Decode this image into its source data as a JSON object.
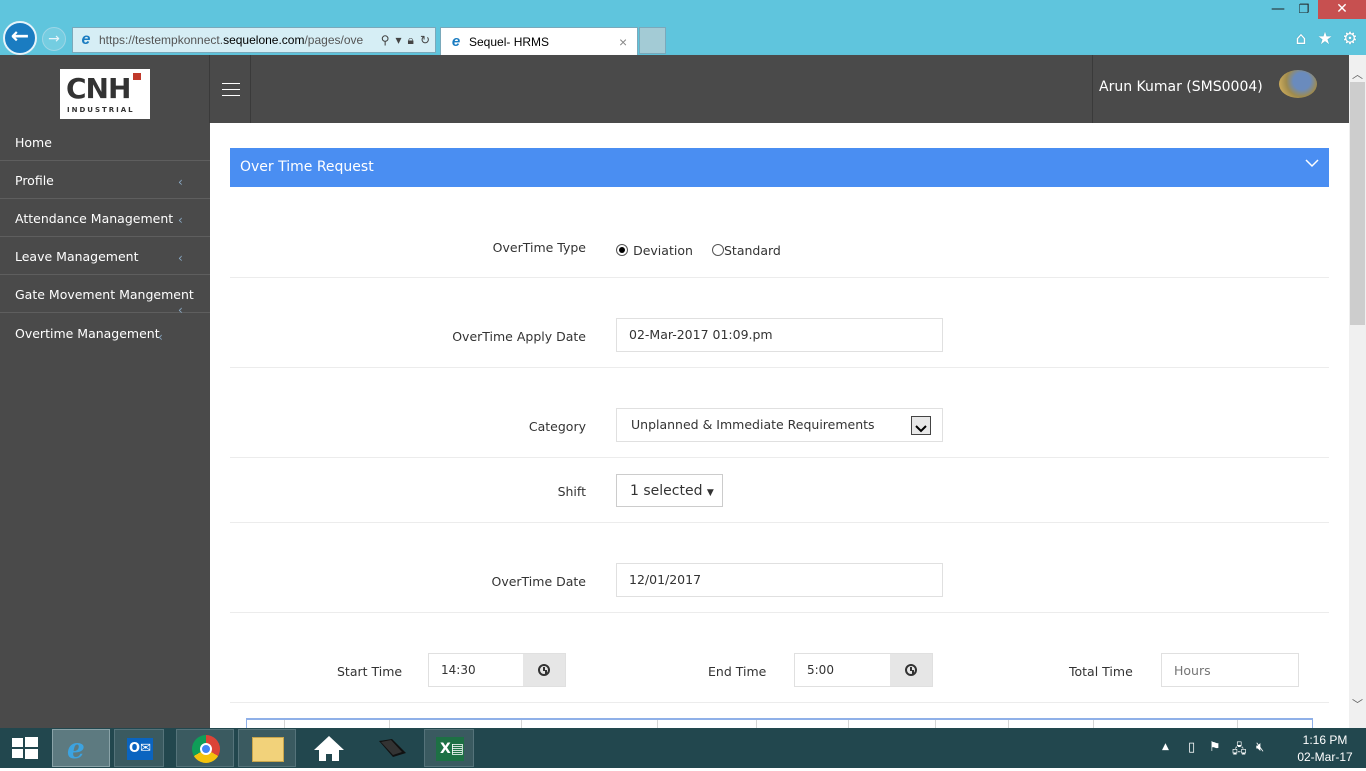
{
  "browser": {
    "url_prefix": "https://testempkonnect.",
    "url_domain": "sequelone.com",
    "url_suffix": "/pages/ove",
    "tab_title": "Sequel- HRMS",
    "tab_close": "×",
    "window_min": "—",
    "window_max": "❐",
    "window_close": "✕",
    "icons": {
      "home": "⌂",
      "favorites": "★",
      "settings": "⚙"
    }
  },
  "header": {
    "logo_main": "CNH",
    "logo_sub": "INDUSTRIAL",
    "user_name": "Arun Kumar (SMS0004)"
  },
  "sidebar": {
    "items": [
      {
        "label": "Home",
        "has_submenu": false
      },
      {
        "label": "Profile",
        "has_submenu": true
      },
      {
        "label": "Attendance Management",
        "has_submenu": true
      },
      {
        "label": "Leave Management",
        "has_submenu": true
      },
      {
        "label": "Gate Movement Mangement",
        "has_submenu": true
      },
      {
        "label": "Overtime Management",
        "has_submenu": true
      }
    ],
    "chevron": "‹"
  },
  "form": {
    "panel_title": "Over Time Request",
    "overtime_type": {
      "label": "OverTime Type",
      "options": [
        "Deviation",
        "Standard"
      ],
      "selected": "Deviation"
    },
    "apply_date": {
      "label": "OverTime Apply Date",
      "value": "02-Mar-2017 01:09.pm"
    },
    "category": {
      "label": "Category",
      "value": "Unplanned & Immediate Requirements"
    },
    "shift": {
      "label": "Shift",
      "value": "1 selected"
    },
    "overtime_date": {
      "label": "OverTime Date",
      "value": "12/01/2017"
    },
    "start_time": {
      "label": "Start Time",
      "value": "14:30"
    },
    "end_time": {
      "label": "End Time",
      "value": "5:00"
    },
    "total_time": {
      "label": "Total Time",
      "value": "",
      "placeholder": "Hours"
    }
  },
  "taskbar": {
    "apps": [
      "Start",
      "Internet Explorer",
      "Outlook",
      "Chrome",
      "File Explorer",
      "Home",
      "Laptop",
      "Excel"
    ],
    "time": "1:16 PM",
    "date": "02-Mar-17"
  }
}
